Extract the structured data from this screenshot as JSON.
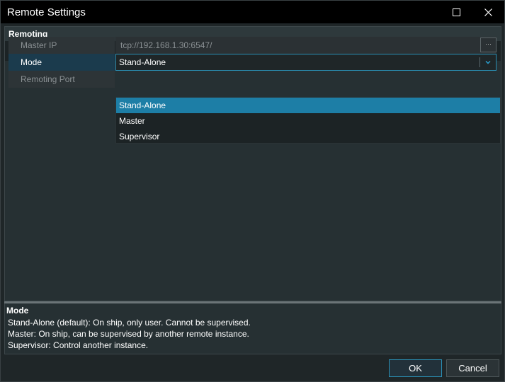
{
  "window": {
    "title": "Remote Settings"
  },
  "section": {
    "title": "Remoting"
  },
  "properties": {
    "master_ip": {
      "label": "Master IP",
      "value": "tcp://192.168.1.30:6547/",
      "button": "···"
    },
    "mode": {
      "label": "Mode",
      "value": "Stand-Alone"
    },
    "remoting_port": {
      "label": "Remoting Port"
    }
  },
  "mode_dropdown": {
    "options": [
      "Stand-Alone",
      "Master",
      "Supervisor"
    ],
    "selected": "Stand-Alone"
  },
  "description": {
    "title": "Mode",
    "lines": [
      "Stand-Alone (default): On ship, only user. Cannot be supervised.",
      "Master: On ship, can be supervised by another remote instance.",
      "Supervisor: Control another instance."
    ]
  },
  "buttons": {
    "ok": "OK",
    "cancel": "Cancel"
  },
  "colors": {
    "accent": "#1d7ea6",
    "focus_border": "#2a8fb4",
    "background": "#1f2628"
  },
  "icons": {
    "maximize": "maximize-icon",
    "close": "close-icon",
    "collapse": "collapse-triangle-icon",
    "dropdown": "chevron-down-icon"
  }
}
